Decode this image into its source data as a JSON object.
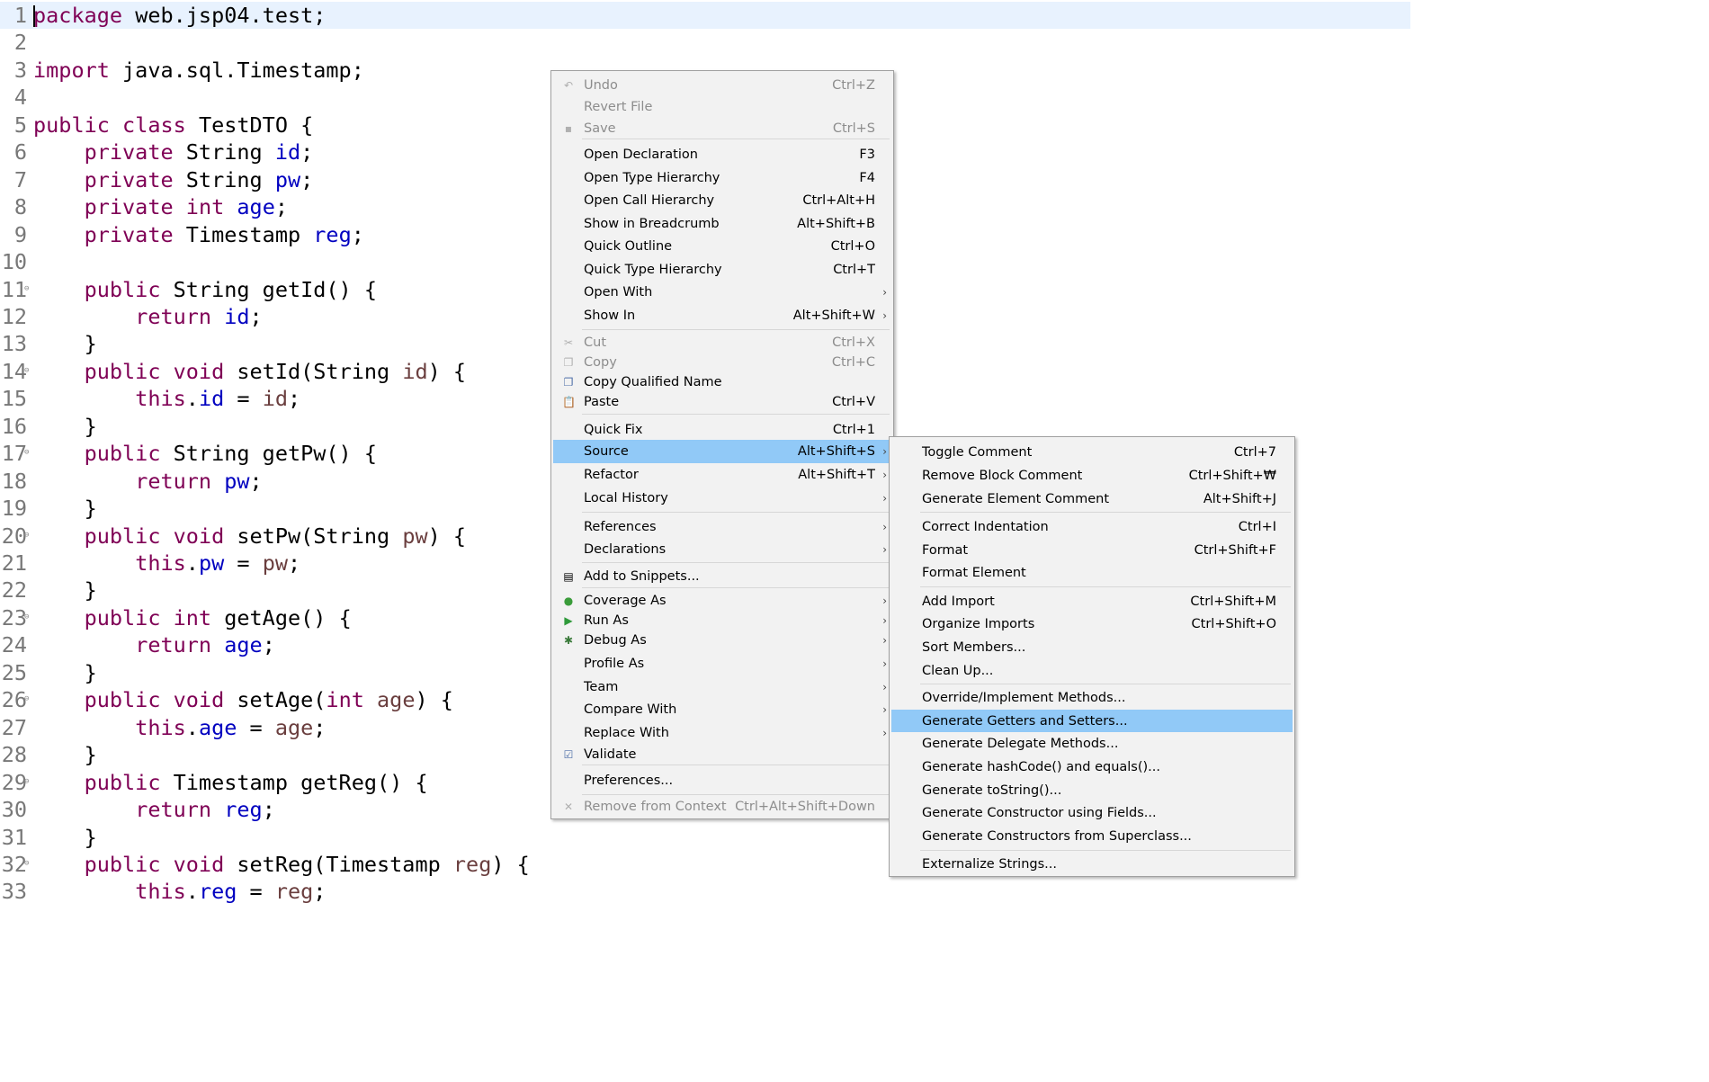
{
  "editor": {
    "lines": [
      {
        "n": "1",
        "segs": [
          [
            "k",
            "package"
          ],
          [
            "t",
            " web.jsp04.test;"
          ]
        ]
      },
      {
        "n": "2",
        "segs": []
      },
      {
        "n": "3",
        "segs": [
          [
            "k",
            "import"
          ],
          [
            "t",
            " java.sql.Timestamp;"
          ]
        ]
      },
      {
        "n": "4",
        "segs": []
      },
      {
        "n": "5",
        "segs": [
          [
            "k",
            "public"
          ],
          [
            "t",
            " "
          ],
          [
            "k",
            "class"
          ],
          [
            "t",
            " TestDTO {"
          ]
        ]
      },
      {
        "n": "6",
        "segs": [
          [
            "t",
            "    "
          ],
          [
            "k",
            "private"
          ],
          [
            "t",
            " String "
          ],
          [
            "f",
            "id"
          ],
          [
            "t",
            ";"
          ]
        ]
      },
      {
        "n": "7",
        "segs": [
          [
            "t",
            "    "
          ],
          [
            "k",
            "private"
          ],
          [
            "t",
            " String "
          ],
          [
            "f",
            "pw"
          ],
          [
            "t",
            ";"
          ]
        ]
      },
      {
        "n": "8",
        "segs": [
          [
            "t",
            "    "
          ],
          [
            "k",
            "private"
          ],
          [
            "t",
            " "
          ],
          [
            "k",
            "int"
          ],
          [
            "t",
            " "
          ],
          [
            "f",
            "age"
          ],
          [
            "t",
            ";"
          ]
        ]
      },
      {
        "n": "9",
        "segs": [
          [
            "t",
            "    "
          ],
          [
            "k",
            "private"
          ],
          [
            "t",
            " Timestamp "
          ],
          [
            "f",
            "reg"
          ],
          [
            "t",
            ";"
          ]
        ]
      },
      {
        "n": "10",
        "segs": []
      },
      {
        "n": "11",
        "fold": true,
        "segs": [
          [
            "t",
            "    "
          ],
          [
            "k",
            "public"
          ],
          [
            "t",
            " String getId() {"
          ]
        ]
      },
      {
        "n": "12",
        "segs": [
          [
            "t",
            "        "
          ],
          [
            "k",
            "return"
          ],
          [
            "t",
            " "
          ],
          [
            "f",
            "id"
          ],
          [
            "t",
            ";"
          ]
        ]
      },
      {
        "n": "13",
        "segs": [
          [
            "t",
            "    }"
          ]
        ]
      },
      {
        "n": "14",
        "fold": true,
        "segs": [
          [
            "t",
            "    "
          ],
          [
            "k",
            "public"
          ],
          [
            "t",
            " "
          ],
          [
            "k",
            "void"
          ],
          [
            "t",
            " setId(String "
          ],
          [
            "p",
            "id"
          ],
          [
            "t",
            ") {"
          ]
        ]
      },
      {
        "n": "15",
        "segs": [
          [
            "t",
            "        "
          ],
          [
            "k",
            "this"
          ],
          [
            "t",
            "."
          ],
          [
            "f",
            "id"
          ],
          [
            "t",
            " = "
          ],
          [
            "p",
            "id"
          ],
          [
            "t",
            ";"
          ]
        ]
      },
      {
        "n": "16",
        "segs": [
          [
            "t",
            "    }"
          ]
        ]
      },
      {
        "n": "17",
        "fold": true,
        "segs": [
          [
            "t",
            "    "
          ],
          [
            "k",
            "public"
          ],
          [
            "t",
            " String getPw() {"
          ]
        ]
      },
      {
        "n": "18",
        "segs": [
          [
            "t",
            "        "
          ],
          [
            "k",
            "return"
          ],
          [
            "t",
            " "
          ],
          [
            "f",
            "pw"
          ],
          [
            "t",
            ";"
          ]
        ]
      },
      {
        "n": "19",
        "segs": [
          [
            "t",
            "    }"
          ]
        ]
      },
      {
        "n": "20",
        "fold": true,
        "segs": [
          [
            "t",
            "    "
          ],
          [
            "k",
            "public"
          ],
          [
            "t",
            " "
          ],
          [
            "k",
            "void"
          ],
          [
            "t",
            " setPw(String "
          ],
          [
            "p",
            "pw"
          ],
          [
            "t",
            ") {"
          ]
        ]
      },
      {
        "n": "21",
        "segs": [
          [
            "t",
            "        "
          ],
          [
            "k",
            "this"
          ],
          [
            "t",
            "."
          ],
          [
            "f",
            "pw"
          ],
          [
            "t",
            " = "
          ],
          [
            "p",
            "pw"
          ],
          [
            "t",
            ";"
          ]
        ]
      },
      {
        "n": "22",
        "segs": [
          [
            "t",
            "    }"
          ]
        ]
      },
      {
        "n": "23",
        "fold": true,
        "segs": [
          [
            "t",
            "    "
          ],
          [
            "k",
            "public"
          ],
          [
            "t",
            " "
          ],
          [
            "k",
            "int"
          ],
          [
            "t",
            " getAge() {"
          ]
        ]
      },
      {
        "n": "24",
        "segs": [
          [
            "t",
            "        "
          ],
          [
            "k",
            "return"
          ],
          [
            "t",
            " "
          ],
          [
            "f",
            "age"
          ],
          [
            "t",
            ";"
          ]
        ]
      },
      {
        "n": "25",
        "segs": [
          [
            "t",
            "    }"
          ]
        ]
      },
      {
        "n": "26",
        "fold": true,
        "segs": [
          [
            "t",
            "    "
          ],
          [
            "k",
            "public"
          ],
          [
            "t",
            " "
          ],
          [
            "k",
            "void"
          ],
          [
            "t",
            " setAge("
          ],
          [
            "k",
            "int"
          ],
          [
            "t",
            " "
          ],
          [
            "p",
            "age"
          ],
          [
            "t",
            ") {"
          ]
        ]
      },
      {
        "n": "27",
        "segs": [
          [
            "t",
            "        "
          ],
          [
            "k",
            "this"
          ],
          [
            "t",
            "."
          ],
          [
            "f",
            "age"
          ],
          [
            "t",
            " = "
          ],
          [
            "p",
            "age"
          ],
          [
            "t",
            ";"
          ]
        ]
      },
      {
        "n": "28",
        "segs": [
          [
            "t",
            "    }"
          ]
        ]
      },
      {
        "n": "29",
        "fold": true,
        "segs": [
          [
            "t",
            "    "
          ],
          [
            "k",
            "public"
          ],
          [
            "t",
            " Timestamp getReg() {"
          ]
        ]
      },
      {
        "n": "30",
        "segs": [
          [
            "t",
            "        "
          ],
          [
            "k",
            "return"
          ],
          [
            "t",
            " "
          ],
          [
            "f",
            "reg"
          ],
          [
            "t",
            ";"
          ]
        ]
      },
      {
        "n": "31",
        "segs": [
          [
            "t",
            "    }"
          ]
        ]
      },
      {
        "n": "32",
        "fold": true,
        "segs": [
          [
            "t",
            "    "
          ],
          [
            "k",
            "public"
          ],
          [
            "t",
            " "
          ],
          [
            "k",
            "void"
          ],
          [
            "t",
            " setReg(Timestamp "
          ],
          [
            "p",
            "reg"
          ],
          [
            "t",
            ") {"
          ]
        ]
      },
      {
        "n": "33",
        "segs": [
          [
            "t",
            "        "
          ],
          [
            "k",
            "this"
          ],
          [
            "t",
            "."
          ],
          [
            "f",
            "reg"
          ],
          [
            "t",
            " = "
          ],
          [
            "p",
            "reg"
          ],
          [
            "t",
            ";"
          ]
        ]
      }
    ]
  },
  "context_menu": {
    "items": [
      {
        "label": "Undo",
        "shortcut": "Ctrl+Z",
        "disabled": true,
        "icon": "undo-icon"
      },
      {
        "label": "Revert File",
        "shortcut": "",
        "disabled": true
      },
      {
        "label": "Save",
        "shortcut": "Ctrl+S",
        "disabled": true,
        "icon": "save-icon"
      },
      {
        "sep": true
      },
      {
        "label": "Open Declaration",
        "shortcut": "F3"
      },
      {
        "label": "Open Type Hierarchy",
        "shortcut": "F4"
      },
      {
        "label": "Open Call Hierarchy",
        "shortcut": "Ctrl+Alt+H"
      },
      {
        "label": "Show in Breadcrumb",
        "shortcut": "Alt+Shift+B"
      },
      {
        "label": "Quick Outline",
        "shortcut": "Ctrl+O"
      },
      {
        "label": "Quick Type Hierarchy",
        "shortcut": "Ctrl+T"
      },
      {
        "label": "Open With",
        "shortcut": "",
        "submenu": true
      },
      {
        "label": "Show In",
        "shortcut": "Alt+Shift+W",
        "submenu": true
      },
      {
        "sep": true
      },
      {
        "label": "Cut",
        "shortcut": "Ctrl+X",
        "disabled": true,
        "icon": "cut-icon"
      },
      {
        "label": "Copy",
        "shortcut": "Ctrl+C",
        "disabled": true,
        "icon": "copy-icon"
      },
      {
        "label": "Copy Qualified Name",
        "shortcut": "",
        "icon": "copy-qualified-name-icon"
      },
      {
        "label": "Paste",
        "shortcut": "Ctrl+V",
        "icon": "paste-icon"
      },
      {
        "sep": true
      },
      {
        "label": "Quick Fix",
        "shortcut": "Ctrl+1"
      },
      {
        "label": "Source",
        "shortcut": "Alt+Shift+S",
        "submenu": true,
        "highlight": true
      },
      {
        "label": "Refactor",
        "shortcut": "Alt+Shift+T",
        "submenu": true
      },
      {
        "label": "Local History",
        "shortcut": "",
        "submenu": true
      },
      {
        "sep": true
      },
      {
        "label": "References",
        "shortcut": "",
        "submenu": true
      },
      {
        "label": "Declarations",
        "shortcut": "",
        "submenu": true
      },
      {
        "sep": true
      },
      {
        "label": "Add to Snippets...",
        "shortcut": "",
        "icon": "snippets-icon"
      },
      {
        "sep": true
      },
      {
        "label": "Coverage As",
        "shortcut": "",
        "submenu": true,
        "icon": "coverage-icon"
      },
      {
        "label": "Run As",
        "shortcut": "",
        "submenu": true,
        "icon": "run-icon"
      },
      {
        "label": "Debug As",
        "shortcut": "",
        "submenu": true,
        "icon": "debug-icon"
      },
      {
        "label": "Profile As",
        "shortcut": "",
        "submenu": true
      },
      {
        "label": "Team",
        "shortcut": "",
        "submenu": true
      },
      {
        "label": "Compare With",
        "shortcut": "",
        "submenu": true
      },
      {
        "label": "Replace With",
        "shortcut": "",
        "submenu": true
      },
      {
        "label": "Validate",
        "shortcut": "",
        "icon": "validate-icon"
      },
      {
        "sep": true
      },
      {
        "label": "Preferences...",
        "shortcut": ""
      },
      {
        "sep": true
      },
      {
        "label": "Remove from Context",
        "shortcut": "Ctrl+Alt+Shift+Down",
        "disabled": true,
        "icon": "remove-context-icon"
      }
    ]
  },
  "source_submenu": {
    "items": [
      {
        "label": "Toggle Comment",
        "shortcut": "Ctrl+7"
      },
      {
        "label": "Remove Block Comment",
        "shortcut": "Ctrl+Shift+₩"
      },
      {
        "label": "Generate Element Comment",
        "shortcut": "Alt+Shift+J"
      },
      {
        "sep": true
      },
      {
        "label": "Correct Indentation",
        "shortcut": "Ctrl+I"
      },
      {
        "label": "Format",
        "shortcut": "Ctrl+Shift+F"
      },
      {
        "label": "Format Element",
        "shortcut": ""
      },
      {
        "sep": true
      },
      {
        "label": "Add Import",
        "shortcut": "Ctrl+Shift+M"
      },
      {
        "label": "Organize Imports",
        "shortcut": "Ctrl+Shift+O"
      },
      {
        "label": "Sort Members...",
        "shortcut": ""
      },
      {
        "label": "Clean Up...",
        "shortcut": ""
      },
      {
        "sep": true
      },
      {
        "label": "Override/Implement Methods...",
        "shortcut": ""
      },
      {
        "label": "Generate Getters and Setters...",
        "shortcut": "",
        "highlight": true
      },
      {
        "label": "Generate Delegate Methods...",
        "shortcut": ""
      },
      {
        "label": "Generate hashCode() and equals()...",
        "shortcut": ""
      },
      {
        "label": "Generate toString()...",
        "shortcut": ""
      },
      {
        "label": "Generate Constructor using Fields...",
        "shortcut": ""
      },
      {
        "label": "Generate Constructors from Superclass...",
        "shortcut": ""
      },
      {
        "sep": true
      },
      {
        "label": "Externalize Strings...",
        "shortcut": ""
      }
    ]
  },
  "colors": {
    "keyword": "#7f0055",
    "field": "#0000c0",
    "param": "#6a3e3e",
    "highlight": "#91c9f7",
    "current_line": "#e8f2fe"
  }
}
